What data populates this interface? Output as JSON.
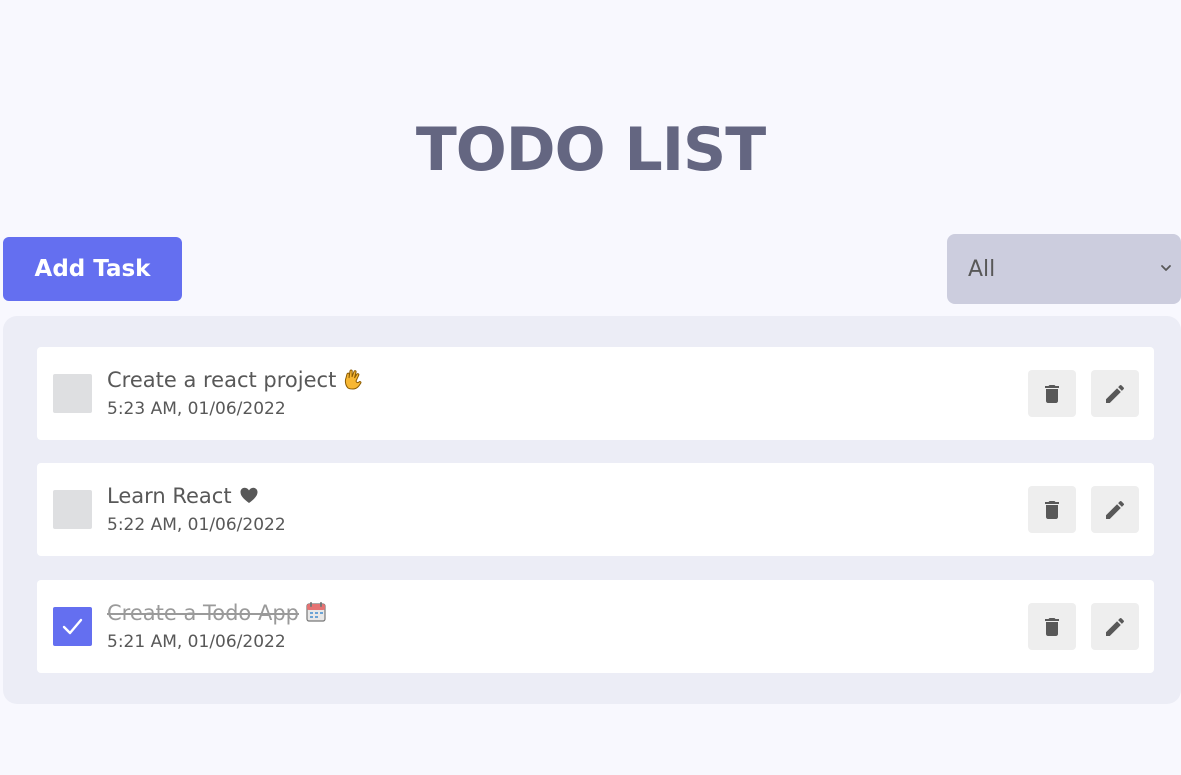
{
  "header": {
    "title": "TODO LIST"
  },
  "toolbar": {
    "add_label": "Add Task",
    "filter_selected": "All",
    "filter_icon": "chevron-down-icon"
  },
  "todos": [
    {
      "title": "Create a react project",
      "time": "5:23 AM, 01/06/2022",
      "completed": false,
      "emoji_icon": "vulcan-salute-icon"
    },
    {
      "title": "Learn React",
      "time": "5:22 AM, 01/06/2022",
      "completed": false,
      "emoji_icon": "heart-icon"
    },
    {
      "title": "Create a Todo App",
      "time": "5:21 AM, 01/06/2022",
      "completed": true,
      "emoji_icon": "calendar-icon"
    }
  ],
  "actions": {
    "delete_icon": "trash-icon",
    "edit_icon": "pencil-icon"
  },
  "colors": {
    "accent": "#646ff0",
    "title": "#646681",
    "background": "#f8f8fe",
    "panel": "#ecedf6",
    "filter_bg": "#cccdde"
  }
}
